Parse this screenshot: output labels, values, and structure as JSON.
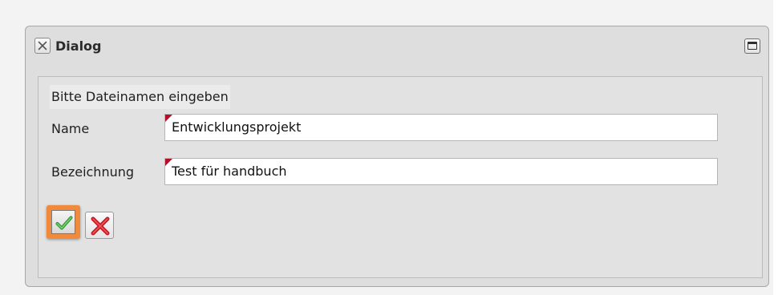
{
  "dialog": {
    "title": "Dialog",
    "close_icon": "close-icon",
    "maximize_icon": "maximize-icon",
    "prompt": "Bitte Dateinamen eingeben",
    "fields": {
      "name": {
        "label": "Name",
        "value": "Entwicklungsprojekt"
      },
      "bezeichnung": {
        "label": "Bezeichnung",
        "value": "Test für handbuch"
      }
    },
    "buttons": {
      "ok_icon": "checkmark-icon",
      "cancel_icon": "cross-icon"
    }
  },
  "colors": {
    "dialog_background": "#dedede",
    "highlight": "#f08a3c",
    "check_green": "#3aa83a",
    "cross_red": "#d8202a",
    "dirty_marker": "#b0112a"
  }
}
